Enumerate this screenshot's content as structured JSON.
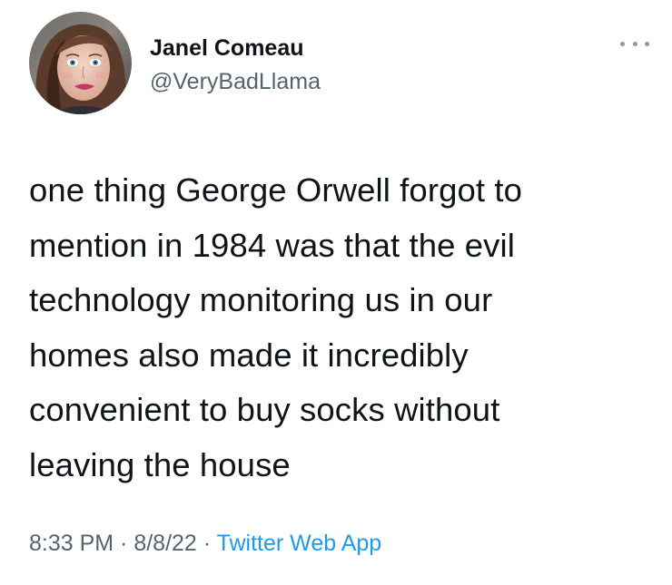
{
  "author": {
    "name": "Janel Comeau",
    "handle": "@VeryBadLlama",
    "avatar_icon": "profile-photo"
  },
  "more_icon": "more-horizontal-icon",
  "tweet": {
    "text": "one thing George Orwell forgot to\nmention in 1984 was that the evil\ntechnology monitoring us in our\nhomes also made it incredibly\nconvenient to buy socks without\nleaving the house"
  },
  "meta": {
    "time": "8:33 PM",
    "separator_1": " · ",
    "date": "8/8/22",
    "separator_2": " · ",
    "source": "Twitter Web App"
  },
  "colors": {
    "text": "#0f1419",
    "secondary": "#536471",
    "link": "#1d9bf0"
  }
}
